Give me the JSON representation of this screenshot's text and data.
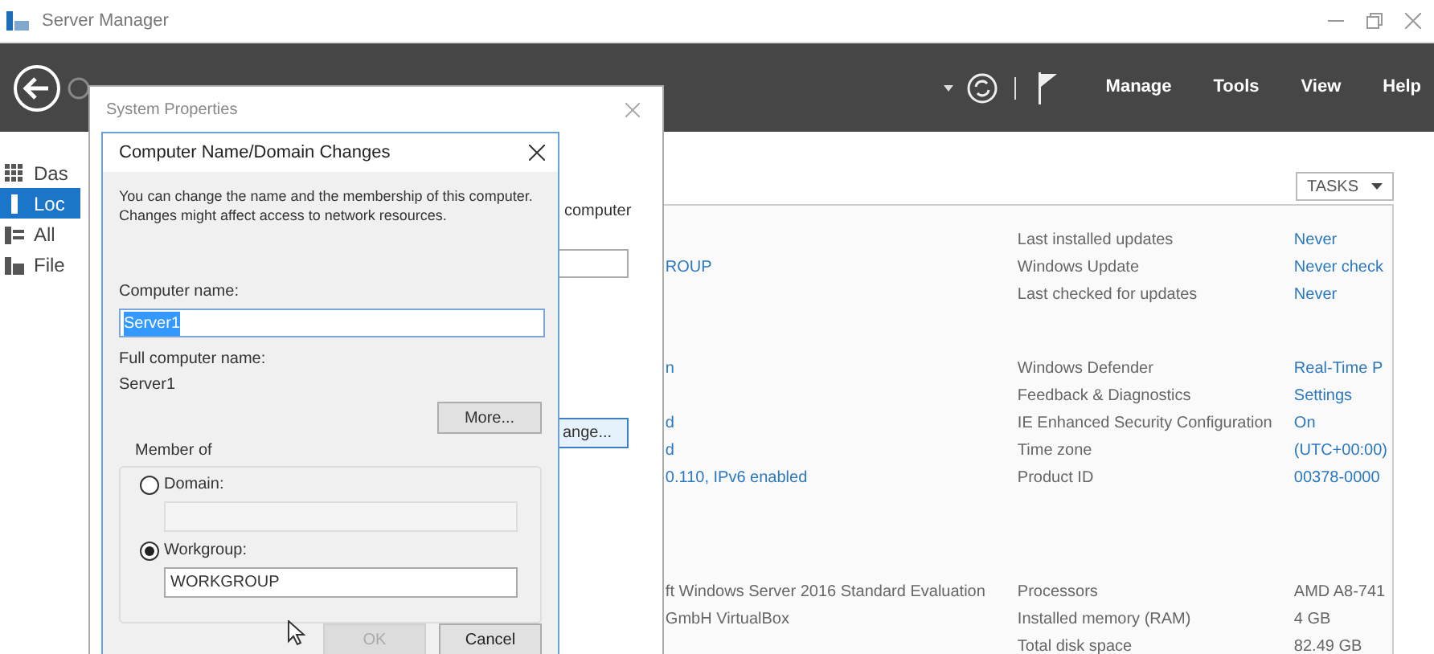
{
  "window": {
    "title": "Server Manager"
  },
  "toolbar": {
    "menus": [
      "Manage",
      "Tools",
      "View",
      "Help"
    ]
  },
  "sidebar": {
    "items": [
      {
        "label": "Das",
        "kind": "dashboard",
        "selected": false
      },
      {
        "label": "Loc",
        "kind": "server",
        "selected": true
      },
      {
        "label": "All",
        "kind": "servers",
        "selected": false
      },
      {
        "label": "File",
        "kind": "files",
        "selected": false
      }
    ]
  },
  "tasks_button": {
    "label": "TASKS"
  },
  "properties": {
    "sections": [
      {
        "rows": [
          {
            "label": "Last installed updates",
            "detail": "Never"
          },
          {
            "value": "ROUP",
            "muted": false,
            "label": "Windows Update",
            "detail": "Never check"
          },
          {
            "label": "Last checked for updates",
            "detail": "Never"
          }
        ]
      },
      {
        "rows": [
          {
            "value": "n",
            "muted": false,
            "label": "Windows Defender",
            "detail": "Real-Time P"
          },
          {
            "label": "Feedback & Diagnostics",
            "detail": "Settings"
          },
          {
            "value": "d",
            "muted": false,
            "label": "IE Enhanced Security Configuration",
            "detail": "On"
          },
          {
            "value": "d",
            "muted": false,
            "label": "Time zone",
            "detail": "(UTC+00:00)"
          },
          {
            "value": "0.110, IPv6 enabled",
            "muted": false,
            "label": "Product ID",
            "detail": "00378-0000"
          }
        ]
      },
      {
        "rows": [
          {
            "value": "ft Windows Server 2016 Standard Evaluation",
            "muted": true,
            "label": "Processors",
            "detail": "AMD A8-741"
          },
          {
            "value": "GmbH VirtualBox",
            "muted": true,
            "label": "Installed memory (RAM)",
            "detail": "4 GB"
          },
          {
            "label": "Total disk space",
            "detail": "82.49 GB"
          }
        ]
      }
    ]
  },
  "system_properties": {
    "title": "System Properties",
    "text_fragment": "computer",
    "button_fragment": "ange..."
  },
  "name_dialog": {
    "title": "Computer Name/Domain Changes",
    "description": "You can change the name and the membership of this computer. Changes might affect access to network resources.",
    "computer_name_label": "Computer name:",
    "computer_name": "Server1",
    "name_selected": true,
    "full_name_label": "Full computer name:",
    "full_name": "Server1",
    "more_button": "More...",
    "member_of": {
      "title": "Member of",
      "options": [
        {
          "label": "Domain:",
          "selected": false
        },
        {
          "label": "Workgroup:",
          "selected": true,
          "value": "WORKGROUP"
        }
      ]
    },
    "buttons": [
      {
        "label": "OK",
        "disabled": true
      },
      {
        "label": "Cancel",
        "disabled": false
      }
    ]
  }
}
